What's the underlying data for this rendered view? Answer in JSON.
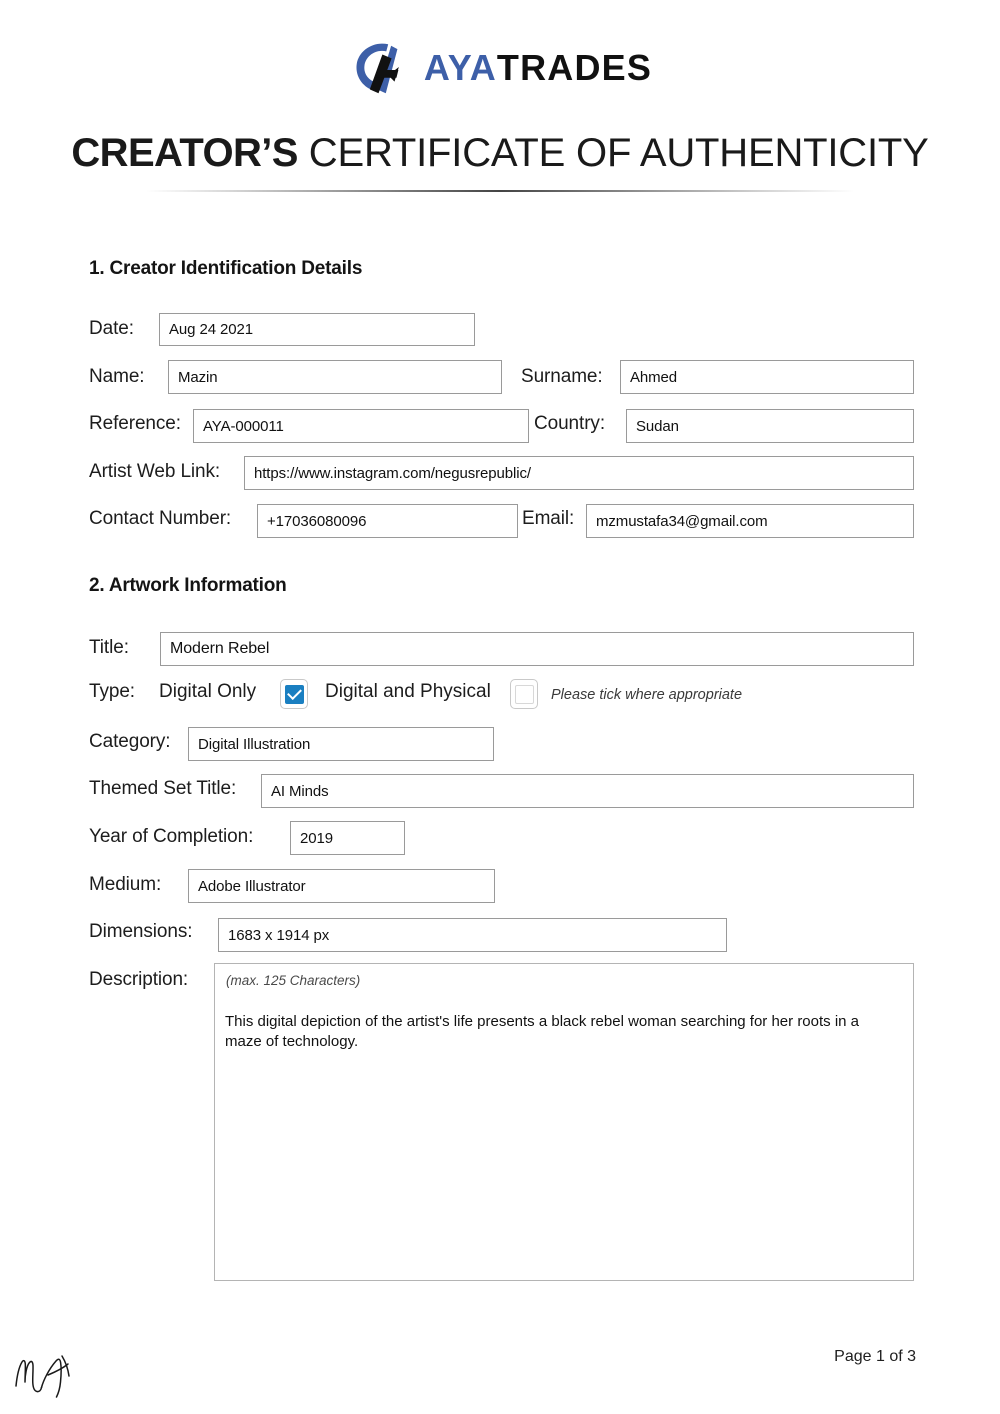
{
  "brand": {
    "logo_icon": "ayatrades-logo-mark",
    "name_part1": "AYA",
    "name_part2": "TRADES",
    "accent_blue": "#3d5fa8",
    "checkbox_blue": "#1a7fc1"
  },
  "header": {
    "title_strong": "CREATOR’S",
    "title_light": "CERTIFICATE OF AUTHENTICITY"
  },
  "sections": {
    "one": "1. Creator Identification Details",
    "two": "2. Artwork Information"
  },
  "creator": {
    "date_label": "Date:",
    "date_value": "Aug 24 2021",
    "name_label": "Name:",
    "name_value": "Mazin",
    "surname_label": "Surname:",
    "surname_value": "Ahmed",
    "reference_label": "Reference:",
    "reference_value": "AYA-000011",
    "country_label": "Country:",
    "country_value": "Sudan",
    "weblink_label": "Artist Web Link:",
    "weblink_value": "https://www.instagram.com/negusrepublic/",
    "contact_label": "Contact Number:",
    "contact_value": "+17036080096",
    "email_label": "Email:",
    "email_value": "mzmustafa34@gmail.com"
  },
  "artwork": {
    "title_label": "Title:",
    "title_value": "Modern Rebel",
    "type_label": "Type:",
    "type_option_1": "Digital Only",
    "type_option_1_checked": true,
    "type_option_2": "Digital and Physical",
    "type_option_2_checked": false,
    "type_hint": "Please tick where appropriate",
    "category_label": "Category:",
    "category_value": "Digital Illustration",
    "themed_set_label": "Themed Set Title:",
    "themed_set_value": "AI Minds",
    "year_label": "Year of Completion:",
    "year_value": "2019",
    "medium_label": "Medium:",
    "medium_value": "Adobe Illustrator",
    "dimensions_label": "Dimensions:",
    "dimensions_value": "1683 x 1914 px",
    "description_label": "Description:",
    "description_maxchars": "(max. 125 Characters)",
    "description_value": "This digital depiction of the artist's life presents a black rebel woman searching for her roots in a maze of technology."
  },
  "footer": {
    "signature_icon": "handwritten-signature-ma",
    "signature_initials": "MA",
    "page_number": "Page 1 of 3"
  }
}
